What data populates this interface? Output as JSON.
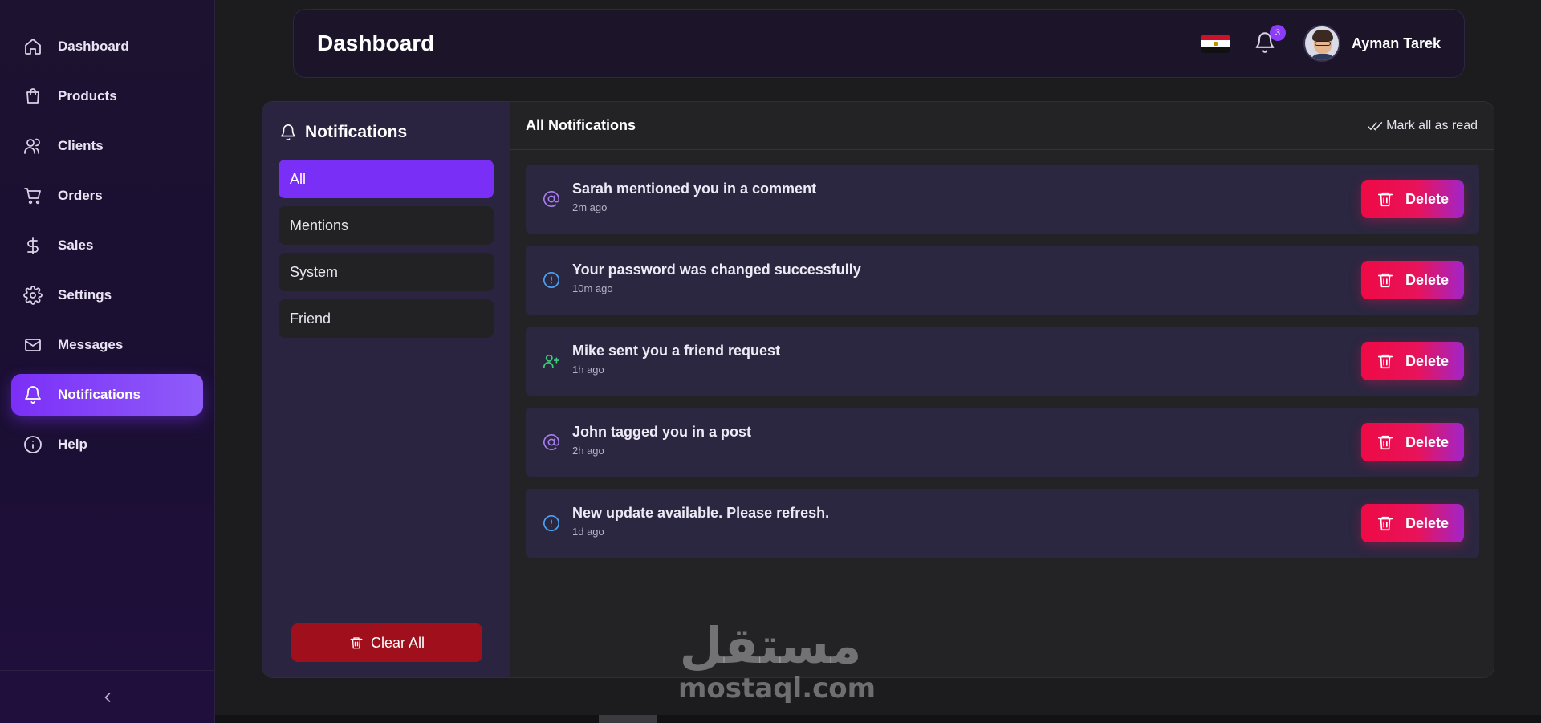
{
  "sidebar": {
    "items": [
      {
        "label": "Dashboard",
        "icon": "home-icon",
        "active": false
      },
      {
        "label": "Products",
        "icon": "shopping-bag-icon",
        "active": false
      },
      {
        "label": "Clients",
        "icon": "users-icon",
        "active": false
      },
      {
        "label": "Orders",
        "icon": "cart-icon",
        "active": false
      },
      {
        "label": "Sales",
        "icon": "dollar-icon",
        "active": false
      },
      {
        "label": "Settings",
        "icon": "gear-icon",
        "active": false
      },
      {
        "label": "Messages",
        "icon": "mail-icon",
        "active": false
      },
      {
        "label": "Notifications",
        "icon": "bell-icon",
        "active": true
      },
      {
        "label": "Help",
        "icon": "info-icon",
        "active": false
      }
    ],
    "collapse_icon": "chevron-left-icon"
  },
  "header": {
    "title": "Dashboard",
    "flag_icon": "egypt-flag-icon",
    "notification_count": "3",
    "user_name": "Ayman Tarek"
  },
  "filters": {
    "title": "Notifications",
    "items": [
      {
        "label": "All",
        "active": true
      },
      {
        "label": "Mentions",
        "active": false
      },
      {
        "label": "System",
        "active": false
      },
      {
        "label": "Friend",
        "active": false
      }
    ],
    "clear_all_label": "Clear All"
  },
  "notifications": {
    "title": "All Notifications",
    "mark_all_label": "Mark all as read",
    "delete_label": "Delete",
    "items": [
      {
        "message": "Sarah mentioned you in a comment",
        "time": "2m ago",
        "type": "mention",
        "icon": "at-sign-icon",
        "color": "#a87ef0"
      },
      {
        "message": "Your password was changed successfully",
        "time": "10m ago",
        "type": "system",
        "icon": "alert-circle-icon",
        "color": "#4ba3f5"
      },
      {
        "message": "Mike sent you a friend request",
        "time": "1h ago",
        "type": "friend",
        "icon": "user-plus-icon",
        "color": "#3ccf7a"
      },
      {
        "message": "John tagged you in a post",
        "time": "2h ago",
        "type": "mention",
        "icon": "at-sign-icon",
        "color": "#a87ef0"
      },
      {
        "message": "New update available. Please refresh.",
        "time": "1d ago",
        "type": "system",
        "icon": "alert-circle-icon",
        "color": "#4ba3f5"
      }
    ]
  },
  "watermark": {
    "arabic": "مستقل",
    "latin": "mostaql.com"
  },
  "colors": {
    "accent": "#7a2ff7",
    "danger": "#ee0a45",
    "clear_all": "#a0101c"
  }
}
